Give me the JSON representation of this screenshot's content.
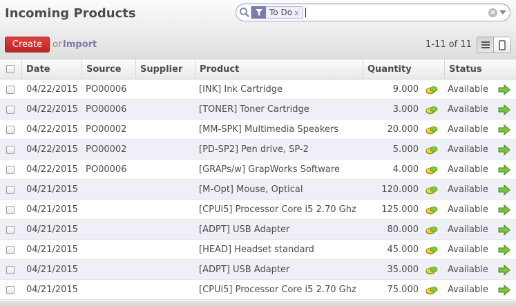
{
  "header": {
    "title": "Incoming Products"
  },
  "search": {
    "facet_label": "To Do",
    "facet_remove": "x",
    "value": ""
  },
  "toolbar": {
    "create_label": "Create",
    "or_text": "or",
    "import_label": "Import"
  },
  "pager": {
    "text": "1-11 of 11"
  },
  "table": {
    "columns": [
      "Date",
      "Source",
      "Supplier",
      "Product",
      "Quantity",
      "Status"
    ],
    "rows": [
      {
        "date": "04/22/2015",
        "source": "PO00006",
        "supplier": "",
        "product": "[INK] Ink Cartridge",
        "quantity": "9.000",
        "status": "Available"
      },
      {
        "date": "04/22/2015",
        "source": "PO00006",
        "supplier": "",
        "product": "[TONER] Toner Cartridge",
        "quantity": "3.000",
        "status": "Available"
      },
      {
        "date": "04/22/2015",
        "source": "PO00002",
        "supplier": "",
        "product": "[MM-SPK] Multimedia Speakers",
        "quantity": "20.000",
        "status": "Available"
      },
      {
        "date": "04/22/2015",
        "source": "PO00002",
        "supplier": "",
        "product": "[PD-SP2] Pen drive, SP-2",
        "quantity": "5.000",
        "status": "Available"
      },
      {
        "date": "04/22/2015",
        "source": "PO00006",
        "supplier": "",
        "product": "[GRAPs/w] GrapWorks Software",
        "quantity": "4.000",
        "status": "Available"
      },
      {
        "date": "04/21/2015",
        "source": "",
        "supplier": "",
        "product": "[M-Opt] Mouse, Optical",
        "quantity": "120.000",
        "status": "Available"
      },
      {
        "date": "04/21/2015",
        "source": "",
        "supplier": "",
        "product": "[CPUi5] Processor Core i5 2.70 Ghz",
        "quantity": "125.000",
        "status": "Available"
      },
      {
        "date": "04/21/2015",
        "source": "",
        "supplier": "",
        "product": "[ADPT] USB Adapter",
        "quantity": "80.000",
        "status": "Available"
      },
      {
        "date": "04/21/2015",
        "source": "",
        "supplier": "",
        "product": "[HEAD] Headset standard",
        "quantity": "45.000",
        "status": "Available"
      },
      {
        "date": "04/21/2015",
        "source": "",
        "supplier": "",
        "product": "[ADPT] USB Adapter",
        "quantity": "35.000",
        "status": "Available"
      },
      {
        "date": "04/21/2015",
        "source": "",
        "supplier": "",
        "product": "[CPUi5] Processor Core i5 2.70 Ghz",
        "quantity": "75.000",
        "status": "Available"
      }
    ]
  },
  "icons": {
    "search": "magnifier-icon",
    "filter": "filter-funnel-icon",
    "clear": "clear-search-icon",
    "dropdown": "search-dropdown-icon",
    "list_view": "list-view-icon",
    "form_view": "form-view-icon",
    "quantity_action": "coins-icon",
    "row_action": "green-arrow-icon"
  },
  "colors": {
    "brand_accent": "#7c7bad",
    "create_button": "#c63030",
    "row_alt": "#eff0f7"
  }
}
